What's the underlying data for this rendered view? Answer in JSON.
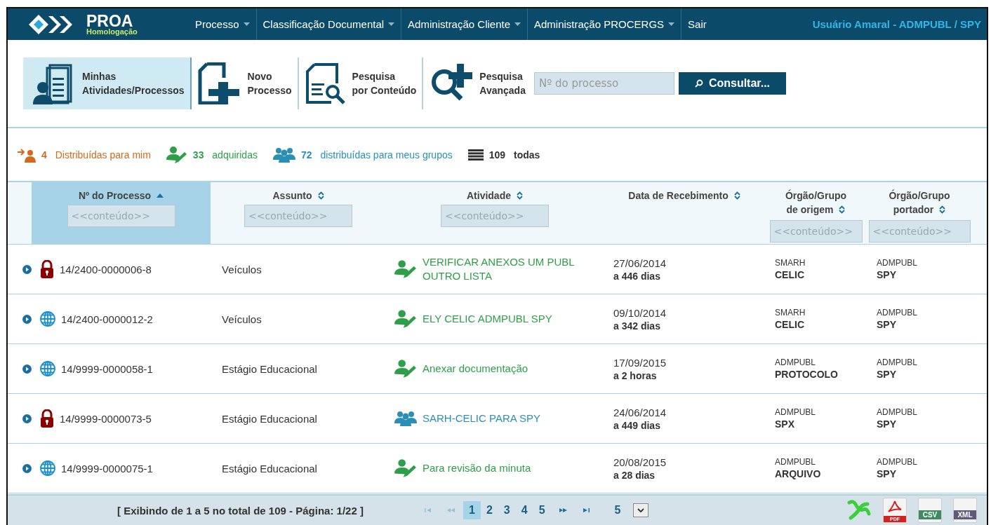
{
  "brand": {
    "name": "PROA",
    "env": "Homologação"
  },
  "menu": [
    {
      "label": "Processo",
      "dropdown": true
    },
    {
      "label": "Classificação Documental",
      "dropdown": true
    },
    {
      "label": "Administração Cliente",
      "dropdown": true
    },
    {
      "label": "Administração PROCERGS",
      "dropdown": true
    },
    {
      "label": "Sair",
      "dropdown": false
    }
  ],
  "user": "Usuário Amaral - ADMPUBL / SPY",
  "toolbar": [
    {
      "kind": "activities",
      "line1": "Minhas",
      "line2": "Atividades/Processos",
      "selected": true
    },
    {
      "kind": "new",
      "line1": "Novo",
      "line2": "Processo",
      "selected": false
    },
    {
      "kind": "content",
      "line1": "Pesquisa",
      "line2": "por Conteúdo",
      "selected": false
    },
    {
      "kind": "advanced",
      "line1": "Pesquisa",
      "line2": "Avançada",
      "selected": false
    }
  ],
  "search": {
    "placeholder": "Nº do processo",
    "button": "Consultar..."
  },
  "filters": [
    {
      "kind": "mine",
      "count": "4",
      "label": "Distribuídas para mim",
      "color": "#d2691e"
    },
    {
      "kind": "acquired",
      "count": "33",
      "label": "adquiridas",
      "color": "#2e9e4a"
    },
    {
      "kind": "groups",
      "count": "72",
      "label": "distribuídas para meus grupos",
      "color": "#2a8fb5"
    },
    {
      "kind": "all",
      "count": "109",
      "label": "todas",
      "color": "#333333"
    }
  ],
  "columns": [
    {
      "lines": [
        "Nº do Processo"
      ],
      "sorted": true,
      "placeholder": "<<conteúdo>>"
    },
    {
      "lines": [
        "Assunto"
      ],
      "sorted": false,
      "placeholder": "<<conteúdo>>"
    },
    {
      "lines": [
        "Atividade"
      ],
      "sorted": false,
      "placeholder": "<<conteúdo>>"
    },
    {
      "lines": [
        "Data de Recebimento"
      ],
      "sorted": false
    },
    {
      "lines": [
        "Órgão/Grupo",
        "de origem"
      ],
      "sorted": false,
      "placeholder": "<<conteúdo>>"
    },
    {
      "lines": [
        "Órgão/Grupo",
        "portador"
      ],
      "sorted": false,
      "placeholder": "<<conteúdo>>"
    }
  ],
  "rows": [
    {
      "locked": true,
      "number": "14/2400-0000006-8",
      "subject": "Veículos",
      "activity": {
        "kind": "acquired",
        "lines": [
          "VERIFICAR ANEXOS UM PUBL",
          "OUTRO LISTA"
        ]
      },
      "date": "27/06/2014",
      "age": "a 446 dias",
      "origin": [
        "SMARH",
        "CELIC"
      ],
      "holder": [
        "ADMPUBL",
        "SPY"
      ]
    },
    {
      "locked": false,
      "number": "14/2400-0000012-2",
      "subject": "Veículos",
      "activity": {
        "kind": "acquired",
        "lines": [
          "ELY CELIC ADMPUBL SPY"
        ]
      },
      "date": "09/10/2014",
      "age": "a 342 dias",
      "origin": [
        "SMARH",
        "CELIC"
      ],
      "holder": [
        "ADMPUBL",
        "SPY"
      ]
    },
    {
      "locked": false,
      "number": "14/9999-0000058-1",
      "subject": "Estágio Educacional",
      "activity": {
        "kind": "acquired",
        "lines": [
          "Anexar documentação"
        ]
      },
      "date": "17/09/2015",
      "age": "a 2 horas",
      "origin": [
        "ADMPUBL",
        "PROTOCOLO"
      ],
      "holder": [
        "ADMPUBL",
        "SPY"
      ]
    },
    {
      "locked": true,
      "number": "14/9999-0000073-5",
      "subject": "Estágio Educacional",
      "activity": {
        "kind": "group",
        "lines": [
          "SARH-CELIC PARA SPY"
        ]
      },
      "date": "24/06/2014",
      "age": "a 449 dias",
      "origin": [
        "ADMPUBL",
        "SPX"
      ],
      "holder": [
        "ADMPUBL",
        "SPY"
      ]
    },
    {
      "locked": false,
      "number": "14/9999-0000075-1",
      "subject": "Estágio Educacional",
      "activity": {
        "kind": "acquired",
        "lines": [
          "Para revisão da minuta"
        ]
      },
      "date": "20/08/2015",
      "age": "a 28 dias",
      "origin": [
        "ADMPUBL",
        "ARQUIVO"
      ],
      "holder": [
        "ADMPUBL",
        "SPY"
      ]
    }
  ],
  "footer": {
    "summary": "[ Exibindo de 1 a 5 no total de 109 - Página: 1/22 ]",
    "pages": [
      {
        "label": "1",
        "selected": true
      },
      {
        "label": "2",
        "selected": false
      },
      {
        "label": "3",
        "selected": false
      },
      {
        "label": "4",
        "selected": false
      },
      {
        "label": "5",
        "selected": false
      }
    ],
    "page_size": "5",
    "exports": [
      {
        "kind": "excel"
      },
      {
        "kind": "pdf",
        "label": "PDF"
      },
      {
        "kind": "csv",
        "label": "CSV"
      },
      {
        "kind": "xml",
        "label": "XML"
      }
    ]
  }
}
